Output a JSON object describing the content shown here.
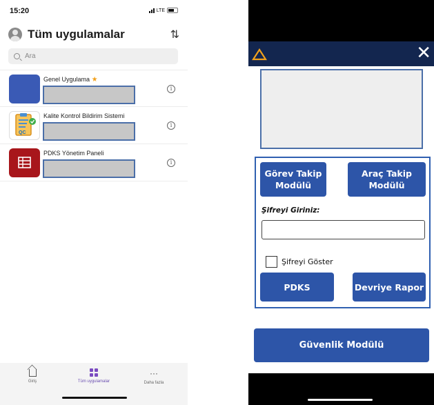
{
  "left_phone": {
    "status_time": "15:20",
    "status_network": "LTE",
    "header_title": "Tüm uygulamalar",
    "sort_icon": "sort-arrows-icon",
    "search_placeholder": "Ara",
    "apps": [
      {
        "name": "Genel Uygulama",
        "favorite_mark": "★",
        "icon": "blue-square-app-icon"
      },
      {
        "name": "Kalite Kontrol Bildirim Sistemi",
        "icon": "qc-clipboard-icon"
      },
      {
        "name": "PDKS Yönetim Paneli",
        "icon": "grid-table-icon"
      }
    ],
    "info_glyph": "i",
    "nav": {
      "home_label": "Giriş",
      "apps_label": "Tüm uygulamalar",
      "more_label": "Daha fazla",
      "more_glyph": "···"
    }
  },
  "right_phone": {
    "close_glyph": "✕",
    "logo_icon": "triangle-logo-icon",
    "gorev_button": "Görev Takip Modülü",
    "arac_button": "Araç Takip Modülü",
    "password_label": "Şifreyi Giriniz:",
    "show_password_label": "Şifreyi Göster",
    "pdks_button": "PDKS",
    "devriye_button": "Devriye Rapor",
    "guvenlik_button": "Güvenlik Modülü"
  },
  "colors": {
    "app_navbar": "#13264f",
    "button_blue": "#2d55a8",
    "accent_gold": "#f2a11c",
    "powerapps_purple": "#7b4bc1"
  }
}
